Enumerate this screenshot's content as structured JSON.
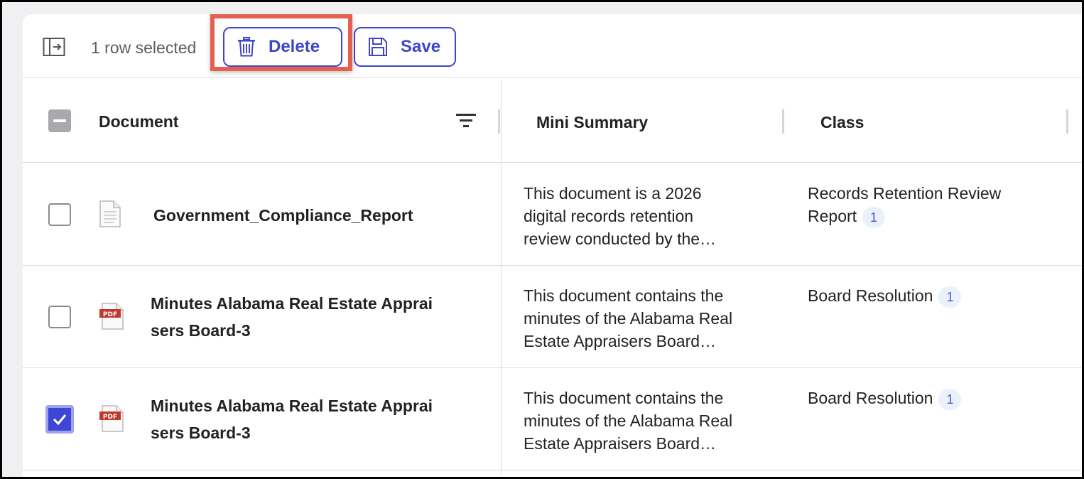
{
  "toolbar": {
    "selection_text": "1 row selected",
    "delete_label": "Delete",
    "save_label": "Save",
    "accent_color": "#3f46c9",
    "highlight_color": "#e5604f"
  },
  "table": {
    "columns": [
      "Document",
      "Mini Summary",
      "Class"
    ],
    "rows": [
      {
        "checked": false,
        "file_icon": "generic-document-icon",
        "document": "Government_Compliance_Report",
        "summary": [
          "This document is a 2026",
          "digital records retention",
          "review conducted by the…"
        ],
        "class": "Records Retention Review Report",
        "count": "1"
      },
      {
        "checked": false,
        "file_icon": "pdf-icon",
        "document": "Minutes Alabama Real Estate Apprai sers Board-3",
        "summary": [
          "This document contains the",
          "minutes of the Alabama Real",
          "Estate Appraisers Board…"
        ],
        "class": "Board Resolution",
        "count": "1"
      },
      {
        "checked": true,
        "file_icon": "pdf-icon",
        "document": "Minutes Alabama Real Estate Apprai sers Board-3",
        "summary": [
          "This document contains the",
          "minutes of the Alabama Real",
          "Estate Appraisers Board…"
        ],
        "class": "Board Resolution",
        "count": "1"
      }
    ]
  },
  "icons": {
    "pdf_label": "PDF"
  }
}
